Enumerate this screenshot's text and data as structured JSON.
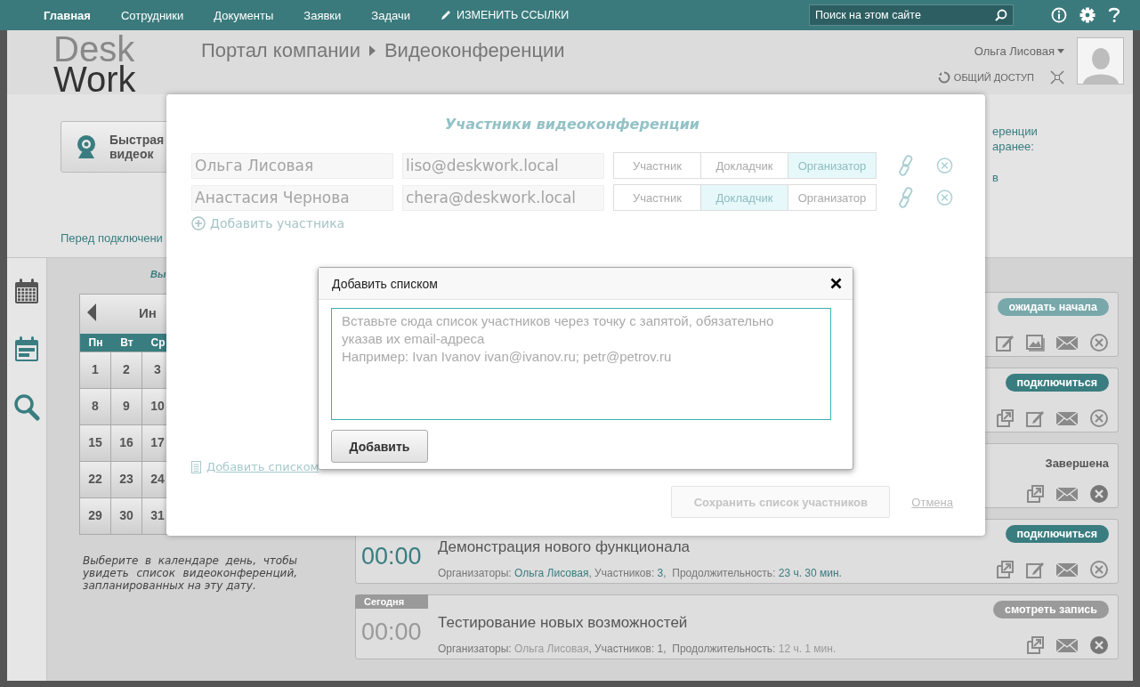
{
  "nav": {
    "items": [
      {
        "label": "Главная",
        "selected": true
      },
      {
        "label": "Сотрудники",
        "selected": false
      },
      {
        "label": "Документы",
        "selected": false
      },
      {
        "label": "Заявки",
        "selected": false
      },
      {
        "label": "Задачи",
        "selected": false
      }
    ],
    "edit_links": "ИЗМЕНИТЬ ССЫЛКИ",
    "search": {
      "placeholder": "Поиск на этом сайте"
    }
  },
  "header": {
    "logo_top": "Desk",
    "logo_bottom": "Work",
    "breadcrumb": [
      "Портал компании",
      "Видеоконференции"
    ],
    "user": "Ольга Лисовая",
    "share": "ОБЩИЙ ДОСТУП"
  },
  "quick_button": {
    "lines": [
      "Быстрая",
      "видеок"
    ]
  },
  "before_note": "Перед подключени",
  "right_note": {
    "lines": [
      "еренции",
      "аранее:"
    ],
    "extra": "в"
  },
  "sidebar": [
    {
      "kind": "calendar",
      "selected": true
    },
    {
      "kind": "planner",
      "selected": false
    },
    {
      "kind": "search",
      "selected": false
    }
  ],
  "calendar": {
    "heading": "Вы",
    "month": "Ин",
    "weekdays": [
      "Пн",
      "Вт",
      "Ср"
    ],
    "weeks": [
      [
        "1",
        "2",
        "3"
      ],
      [
        "8",
        "9",
        "10"
      ],
      [
        "15",
        "16",
        "17"
      ],
      [
        "22",
        "23",
        "24"
      ],
      [
        "29",
        "30",
        "31"
      ]
    ]
  },
  "calendar_hint": "Выберите в календаре день, чтобы увидеть список видеоконференций, запланированных на эту дату.",
  "conferences": [
    {
      "status": {
        "text": "ожидать начала",
        "kind": "waiting"
      },
      "actions": [
        {
          "kind": "edit"
        },
        {
          "kind": "image"
        },
        {
          "kind": "mail"
        },
        {
          "kind": "remove"
        }
      ]
    },
    {
      "status": {
        "text": "подключиться",
        "kind": "connect"
      },
      "actions": [
        {
          "kind": "export"
        },
        {
          "kind": "edit"
        },
        {
          "kind": "mail"
        },
        {
          "kind": "remove"
        }
      ]
    },
    {
      "status": {
        "text": "Завершена",
        "kind": "label"
      },
      "actions": [
        {
          "kind": "export"
        },
        {
          "kind": "mail"
        },
        {
          "kind": "remove-filled"
        }
      ]
    },
    {
      "time": "00:00",
      "live": true,
      "title": "Демонстрация нового функционала",
      "meta": [
        {
          "text": "Организаторы: ",
          "accent": false
        },
        {
          "text": "Ольга Лисовая",
          "accent": true
        },
        {
          "text": ", Участников: ",
          "accent": false
        },
        {
          "text": "3",
          "accent": true
        },
        {
          "text": ",  Продолжительность: ",
          "accent": false
        },
        {
          "text": "23 ч. 30 мин.",
          "accent": true
        }
      ],
      "status": {
        "text": "подключиться",
        "kind": "connect"
      },
      "actions": [
        {
          "kind": "export"
        },
        {
          "kind": "edit"
        },
        {
          "kind": "mail"
        },
        {
          "kind": "remove"
        }
      ]
    },
    {
      "tag": "Сегодня",
      "time": "00:00",
      "live": false,
      "title": "Тестирование новых возможностей",
      "meta": [
        {
          "text": "Организаторы: ",
          "accent": false
        },
        {
          "text": "Ольга Лисовая",
          "accent": true
        },
        {
          "text": ", Участников: ",
          "accent": false
        },
        {
          "text": "1",
          "accent": false
        },
        {
          "text": ",  Продолжительность: ",
          "accent": false
        },
        {
          "text": "12 ч. 1 мин.",
          "accent": true
        }
      ],
      "status": {
        "text": "смотреть запись",
        "kind": "record"
      },
      "actions": [
        {
          "kind": "export"
        },
        {
          "kind": "mail"
        },
        {
          "kind": "remove-filled"
        }
      ]
    }
  ],
  "modal": {
    "title": "Участники видеоконференции",
    "participants": [
      {
        "name": "Ольга Лисовая",
        "email": "liso@deskwork.local",
        "roles": [
          {
            "label": "Участник",
            "selected": false
          },
          {
            "label": "Докладчик",
            "selected": false
          },
          {
            "label": "Организатор",
            "selected": true
          }
        ]
      },
      {
        "name": "Анастасия Чернова",
        "email": "chera@deskwork.local",
        "roles": [
          {
            "label": "Участник",
            "selected": false
          },
          {
            "label": "Докладчик",
            "selected": true
          },
          {
            "label": "Организатор",
            "selected": false
          }
        ]
      }
    ],
    "add_participant": "Добавить участника",
    "add_list": "Добавить списком",
    "save": "Сохранить список участников",
    "cancel": "Отмена"
  },
  "dialog": {
    "title": "Добавить списком",
    "placeholder": "Вставьте сюда список участников через точку с запятой, обязательно указав их email-адреса\nНапример: Ivan Ivanov ivan@ivanov.ru; petr@petrov.ru",
    "button": "Добавить"
  }
}
